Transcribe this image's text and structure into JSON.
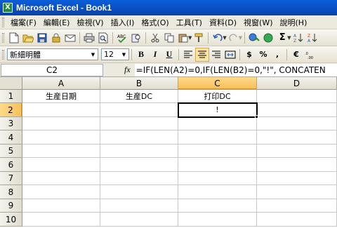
{
  "window": {
    "title": "Microsoft Excel - Book1",
    "icon": "excel-icon"
  },
  "menu": [
    "檔案(F)",
    "編輯(E)",
    "檢視(V)",
    "插入(I)",
    "格式(O)",
    "工具(T)",
    "資料(D)",
    "視窗(W)",
    "說明(H)"
  ],
  "toolbar": {
    "font_name": "新細明體",
    "font_size": "12",
    "bold_label": "B",
    "italic_label": "I",
    "underline_label": "U",
    "currency_label": "$",
    "percent_label": "%",
    "comma_label": ",",
    "euro_label": "€",
    "sigma_label": "Σ"
  },
  "formula_bar": {
    "name_box": "C2",
    "fx_label": "fx",
    "formula": "=IF(LEN(A2)=0,IF(LEN(B2)=0,\"!\", CONCATEN"
  },
  "sheet": {
    "columns": [
      "A",
      "B",
      "C",
      "D"
    ],
    "rows": [
      "1",
      "2",
      "3",
      "4",
      "5",
      "6",
      "7",
      "8",
      "9",
      "10"
    ],
    "headers": [
      "生産日期",
      "生産DC",
      "打印DC"
    ],
    "c2_value": "!",
    "active_column": "C",
    "active_row": "2"
  },
  "colors": {
    "title_bar": "#0b4fc4",
    "selected_header": "#f7c15a"
  }
}
